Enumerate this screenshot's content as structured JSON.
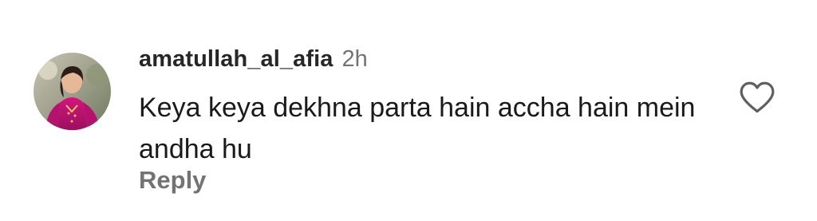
{
  "comment": {
    "username": "amatullah_al_afia",
    "time_ago": "2h",
    "text": "Keya keya dekhna parta hain accha hain mein andha hu",
    "reply_label": "Reply",
    "like_icon": "heart-outline-icon",
    "avatar_icon": "avatar-photo"
  },
  "colors": {
    "username": "#262626",
    "secondary_text": "#737373",
    "body_text": "#1a1a1a",
    "heart_outline": "#5f5f5f"
  }
}
